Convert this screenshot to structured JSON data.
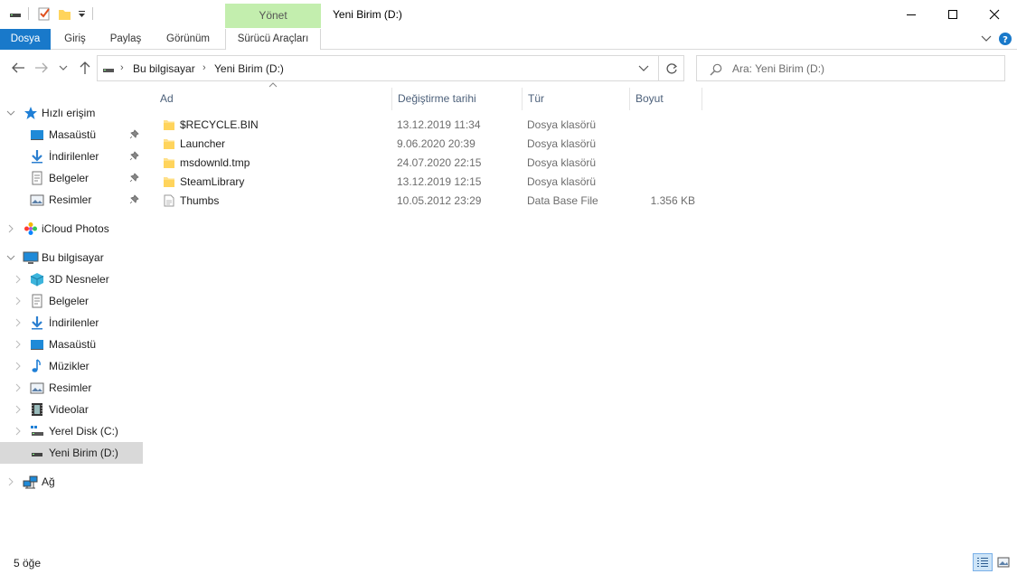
{
  "window": {
    "title": "Yeni Birim (D:)",
    "context_tab_header": "Yönet"
  },
  "ribbon": {
    "tabs": [
      "Dosya",
      "Giriş",
      "Paylaş",
      "Görünüm",
      "Sürücü Araçları"
    ]
  },
  "address": {
    "breadcrumb": [
      "Bu bilgisayar",
      "Yeni Birim (D:)"
    ],
    "search_placeholder": "Ara: Yeni Birim (D:)"
  },
  "nav": {
    "quick_access": {
      "label": "Hızlı erişim",
      "items": [
        {
          "label": "Masaüstü",
          "icon": "desktop-icon",
          "pinned": true
        },
        {
          "label": "İndirilenler",
          "icon": "download-icon",
          "pinned": true
        },
        {
          "label": "Belgeler",
          "icon": "documents-icon",
          "pinned": true
        },
        {
          "label": "Resimler",
          "icon": "pictures-icon",
          "pinned": true
        }
      ]
    },
    "icloud": {
      "label": "iCloud Photos"
    },
    "this_pc": {
      "label": "Bu bilgisayar",
      "items": [
        {
          "label": "3D Nesneler",
          "icon": "3d-objects-icon"
        },
        {
          "label": "Belgeler",
          "icon": "documents-icon"
        },
        {
          "label": "İndirilenler",
          "icon": "download-icon"
        },
        {
          "label": "Masaüstü",
          "icon": "desktop-icon"
        },
        {
          "label": "Müzikler",
          "icon": "music-icon"
        },
        {
          "label": "Resimler",
          "icon": "pictures-icon"
        },
        {
          "label": "Videolar",
          "icon": "videos-icon"
        },
        {
          "label": "Yerel Disk (C:)",
          "icon": "local-disk-icon"
        },
        {
          "label": "Yeni Birim (D:)",
          "icon": "drive-icon",
          "selected": true
        }
      ]
    },
    "network": {
      "label": "Ağ"
    }
  },
  "columns": {
    "name": "Ad",
    "date": "Değiştirme tarihi",
    "type": "Tür",
    "size": "Boyut"
  },
  "files": [
    {
      "name": "$RECYCLE.BIN",
      "date": "13.12.2019 11:34",
      "type": "Dosya klasörü",
      "size": "",
      "icon": "folder-icon"
    },
    {
      "name": "Launcher",
      "date": "9.06.2020 20:39",
      "type": "Dosya klasörü",
      "size": "",
      "icon": "folder-icon"
    },
    {
      "name": "msdownld.tmp",
      "date": "24.07.2020 22:15",
      "type": "Dosya klasörü",
      "size": "",
      "icon": "folder-icon"
    },
    {
      "name": "SteamLibrary",
      "date": "13.12.2019 12:15",
      "type": "Dosya klasörü",
      "size": "",
      "icon": "folder-icon"
    },
    {
      "name": "Thumbs",
      "date": "10.05.2012 23:29",
      "type": "Data Base File",
      "size": "1.356 KB",
      "icon": "file-icon"
    }
  ],
  "status": {
    "item_count": "5 öğe"
  },
  "colors": {
    "file_tab": "#1979ca",
    "manage_tab": "#c3eeae",
    "selected_nav": "#d9d9d9",
    "folder": "#ffe08a"
  }
}
